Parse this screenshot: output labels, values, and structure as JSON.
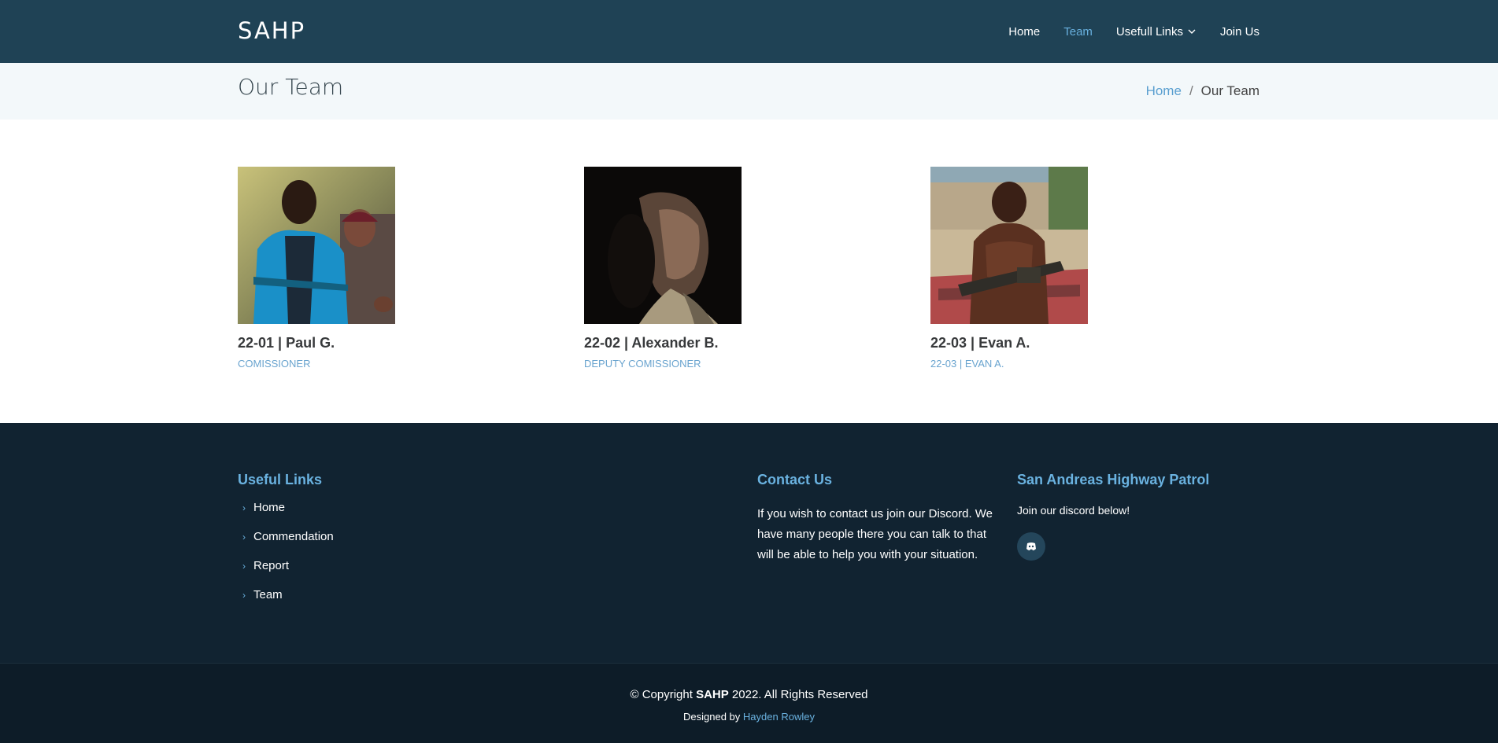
{
  "header": {
    "logo": "SAHP",
    "nav": [
      {
        "label": "Home"
      },
      {
        "label": "Team"
      },
      {
        "label": "Usefull Links"
      },
      {
        "label": "Join Us"
      }
    ]
  },
  "breadcrumb_bar": {
    "title": "Our Team",
    "home": "Home",
    "separator": "/",
    "current": "Our Team"
  },
  "team": [
    {
      "name": "22-01 | Paul G.",
      "role": "COMISSIONER"
    },
    {
      "name": "22-02 | Alexander B.",
      "role": "DEPUTY COMISSIONER"
    },
    {
      "name": "22-03 | Evan A.",
      "role": "22-03 | EVAN A."
    }
  ],
  "footer": {
    "useful_links": {
      "heading": "Useful Links",
      "items": [
        {
          "label": "Home"
        },
        {
          "label": "Commendation"
        },
        {
          "label": "Report"
        },
        {
          "label": "Team"
        }
      ]
    },
    "contact": {
      "heading": "Contact Us",
      "text": "If you wish to contact us join our Discord. We have many people there you can talk to that will be able to help you with your situation."
    },
    "org": {
      "heading": "San Andreas Highway Patrol",
      "text": "Join our discord below!",
      "icon": "discord-icon"
    }
  },
  "bottom": {
    "copyright_prefix": "© Copyright",
    "brand": "SAHP",
    "copyright_suffix": "2022. All Rights Reserved",
    "designed_by": "Designed by",
    "author": "Hayden Rowley"
  },
  "colors": {
    "header_bg": "#1f4255",
    "accent": "#68b0de",
    "footer_bg": "#112331",
    "bottom_bg": "#0d1c28"
  }
}
